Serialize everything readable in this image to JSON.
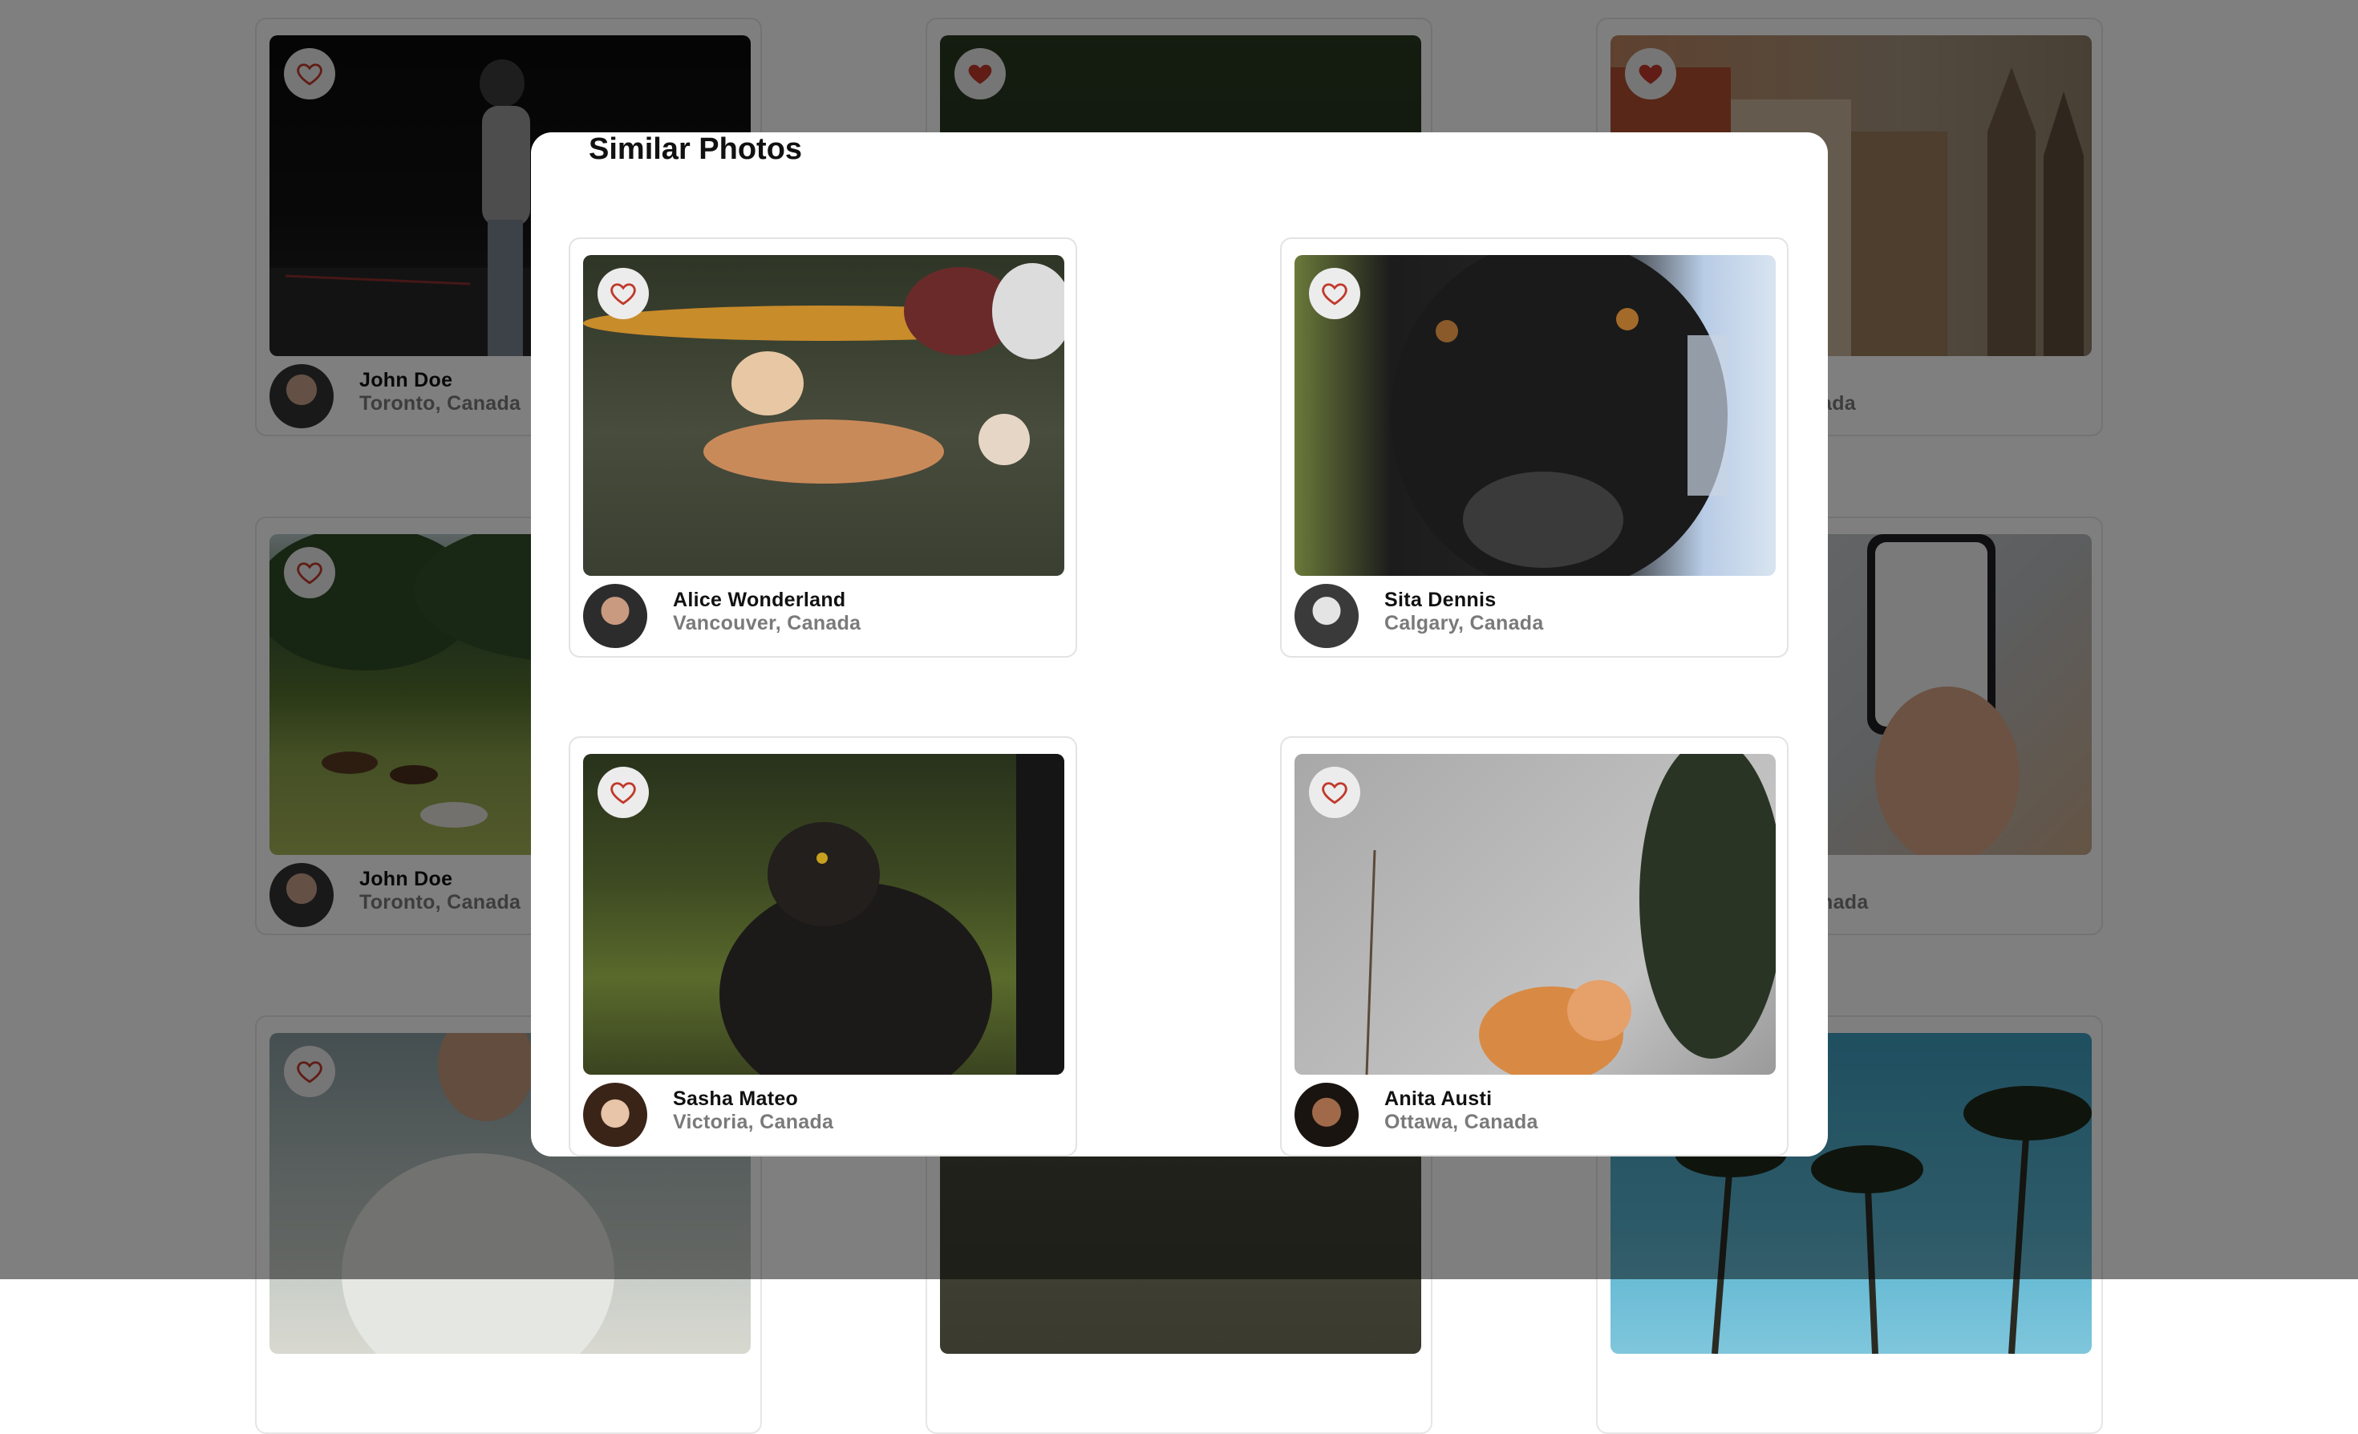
{
  "background_cards": [
    {
      "name": "John Doe",
      "location": "Toronto, Canada",
      "liked": false
    },
    {
      "name": "",
      "location": "",
      "liked": true
    },
    {
      "name": "",
      "location": "ada",
      "liked": true
    },
    {
      "name": "John Doe",
      "location": "Toronto, Canada",
      "liked": false
    },
    {
      "name": "",
      "location": "",
      "liked": false
    },
    {
      "name": "",
      "location": "nada",
      "liked": false
    },
    {
      "name": "",
      "location": "",
      "liked": false
    },
    {
      "name": "",
      "location": "",
      "liked": false
    },
    {
      "name": "",
      "location": "",
      "liked": false
    }
  ],
  "modal": {
    "title": "Similar Photos",
    "cards": [
      {
        "name": "Alice Wonderland",
        "location": "Vancouver, Canada",
        "liked": false,
        "photo": "dog-lying-on-grass"
      },
      {
        "name": "Sita Dennis",
        "location": "Calgary, Canada",
        "liked": false,
        "photo": "black-dog-closeup"
      },
      {
        "name": "Sasha Mateo",
        "location": "Victoria, Canada",
        "liked": false,
        "photo": "black-cat"
      },
      {
        "name": "Anita Austi",
        "location": "Ottawa, Canada",
        "liked": false,
        "photo": "orange-cat-wall"
      }
    ]
  },
  "icons": {
    "heart": "heart-icon",
    "avatar": "avatar"
  },
  "colors": {
    "heart": "#c0392b",
    "overlay": "rgba(0,0,0,0.5)"
  }
}
